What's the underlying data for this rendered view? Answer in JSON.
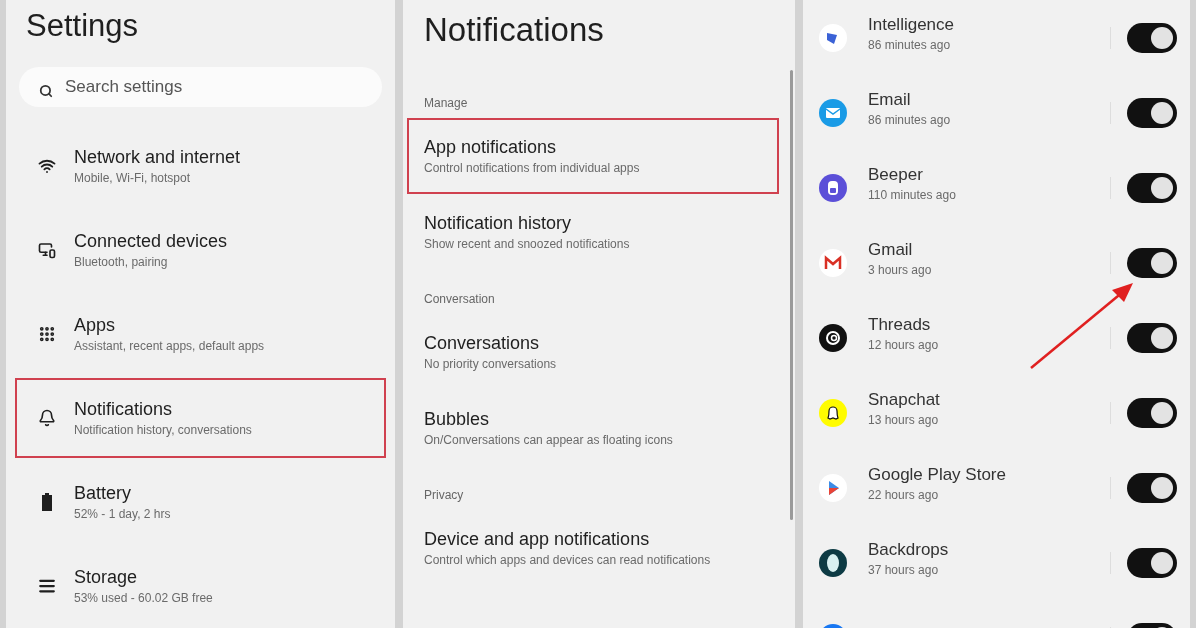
{
  "settings": {
    "title": "Settings",
    "search": {
      "placeholder": "Search settings"
    },
    "items": [
      {
        "kind": "wifi",
        "title": "Network and internet",
        "subtitle": "Mobile, Wi-Fi, hotspot",
        "selected": false
      },
      {
        "kind": "devices",
        "title": "Connected devices",
        "subtitle": "Bluetooth, pairing",
        "selected": false
      },
      {
        "kind": "apps",
        "title": "Apps",
        "subtitle": "Assistant, recent apps, default apps",
        "selected": false
      },
      {
        "kind": "bell",
        "title": "Notifications",
        "subtitle": "Notification history, conversations",
        "selected": true
      },
      {
        "kind": "battery",
        "title": "Battery",
        "subtitle": "52% - 1 day, 2 hrs",
        "selected": false
      },
      {
        "kind": "storage",
        "title": "Storage",
        "subtitle": "53% used - 60.02 GB free",
        "selected": false
      }
    ]
  },
  "notifications": {
    "title": "Notifications",
    "sections": [
      {
        "header": "Manage",
        "items": [
          {
            "title": "App notifications",
            "subtitle": "Control notifications from individual apps",
            "selected": true
          },
          {
            "title": "Notification history",
            "subtitle": "Show recent and snoozed notifications",
            "selected": false
          }
        ]
      },
      {
        "header": "Conversation",
        "items": [
          {
            "title": "Conversations",
            "subtitle": "No priority conversations",
            "selected": false
          },
          {
            "title": "Bubbles",
            "subtitle": "On/Conversations can appear as floating icons",
            "selected": false
          }
        ]
      },
      {
        "header": "Privacy",
        "items": [
          {
            "title": "Device and app notifications",
            "subtitle": "Control which apps and devices can read notifications",
            "selected": false
          }
        ]
      }
    ]
  },
  "app_list": {
    "apps": [
      {
        "kind": "intelligence",
        "name": "Intelligence",
        "time": "86 minutes ago",
        "on": true
      },
      {
        "kind": "email",
        "name": "Email",
        "time": "86 minutes ago",
        "on": true
      },
      {
        "kind": "beeper",
        "name": "Beeper",
        "time": "110 minutes ago",
        "on": true
      },
      {
        "kind": "gmail",
        "name": "Gmail",
        "time": "3 hours ago",
        "on": true
      },
      {
        "kind": "threads",
        "name": "Threads",
        "time": "12 hours ago",
        "on": true
      },
      {
        "kind": "snapchat",
        "name": "Snapchat",
        "time": "13 hours ago",
        "on": true
      },
      {
        "kind": "play",
        "name": "Google Play Store",
        "time": "22 hours ago",
        "on": true
      },
      {
        "kind": "backdrops",
        "name": "Backdrops",
        "time": "37 hours ago",
        "on": true
      },
      {
        "kind": "facebook",
        "on": true
      }
    ]
  }
}
